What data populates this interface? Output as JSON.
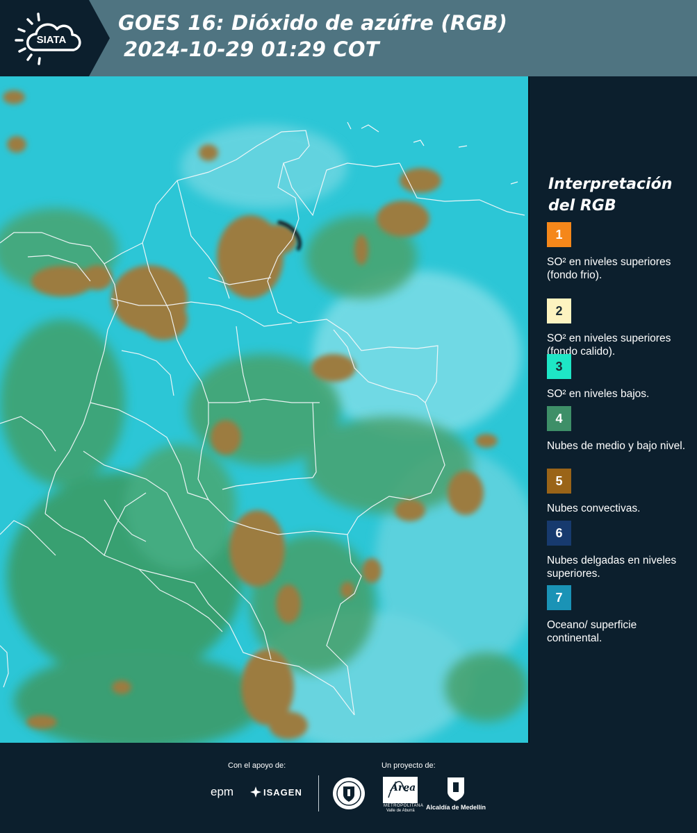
{
  "header": {
    "logo_text": "SIATA",
    "title_line1": "GOES 16: Dióxido de azúfre (RGB)",
    "title_line2": "2024-10-29 01:29 COT"
  },
  "map": {
    "icon": "satellite-rgb-composite-map",
    "colors": {
      "background_cyan": "#27c4d4",
      "low_cloud_green": "#3f9a62",
      "convective_brown": "#9a7b42",
      "border_lines": "#ffffff"
    }
  },
  "legend": {
    "title_line1": "Interpretación",
    "title_line2": "del RGB",
    "items": [
      {
        "number": "1",
        "color": "#f5871a",
        "label": "SO² en niveles superiores (fondo frio)."
      },
      {
        "number": "2",
        "color": "#fdf3c0",
        "label": "SO² en niveles superiores (fondo calido)."
      },
      {
        "number": "3",
        "color": "#1ee6c6",
        "label": "SO² en niveles bajos."
      },
      {
        "number": "4",
        "color": "#3e8f68",
        "label": "Nubes de medio y bajo nivel."
      },
      {
        "number": "5",
        "color": "#9a6418",
        "label": "Nubes convectivas."
      },
      {
        "number": "6",
        "color": "#173a6e",
        "label": "Nubes delgadas en niveles superiores."
      },
      {
        "number": "7",
        "color": "#1a93b6",
        "label": "Oceano/ superficie continental."
      }
    ]
  },
  "footer": {
    "support_label": "Con el apoyo de:",
    "project_label": "Un proyecto de:",
    "epm_text": "epm",
    "isagen_text": "ISAGEN",
    "area_text": "Área",
    "area_sub1": "METROPOLITANA",
    "area_sub2": "Valle de Aburrá",
    "alcaldia_text": "Alcaldía de Medellín"
  }
}
